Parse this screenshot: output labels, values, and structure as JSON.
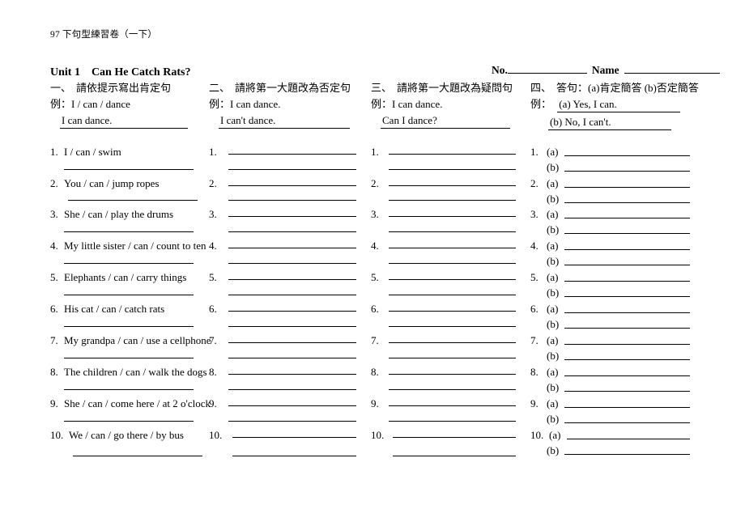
{
  "document": {
    "running_head": "97 下句型練習卷（一下）",
    "unit_title": "Unit 1　Can He Catch Rats?",
    "id_fields": {
      "no_label": "No.",
      "name_label": "Name"
    }
  },
  "sections": [
    {
      "number": "一、",
      "heading": "請依提示寫出肯定句",
      "example_label": "例：",
      "example_prompt": "I / can / dance",
      "example_answers": [
        "I can dance."
      ]
    },
    {
      "number": "二、",
      "heading": "請將第一大題改為否定句",
      "example_label": "例：",
      "example_prompt": "I can dance.",
      "example_answers": [
        "I can't dance."
      ]
    },
    {
      "number": "三、",
      "heading": "請將第一大題改為疑問句",
      "example_label": "例：",
      "example_prompt": "I can dance.",
      "example_answers": [
        "Can I dance?"
      ]
    },
    {
      "number": "四、",
      "heading": "答句：(a)肯定簡答 (b)否定簡答",
      "example_label": "例：",
      "example_prompt": "",
      "example_answers": [
        "(a) Yes, I can.",
        "(b) No, I can't."
      ]
    }
  ],
  "questions": {
    "numbers": [
      "1.",
      "2.",
      "3.",
      "4.",
      "5.",
      "6.",
      "7.",
      "8.",
      "9.",
      "10."
    ],
    "column1_prompts": [
      "I / can / swim",
      "You / can / jump ropes",
      "She / can / play the drums",
      "My little sister / can / count to ten",
      "Elephants / can / carry things",
      "His cat / can / catch rats",
      "My grandpa / can / use a cellphone",
      "The children / can / walk the dogs",
      "She / can / come here / at 2 o'clock",
      "We / can / go there / by bus"
    ],
    "column4_sub_labels": [
      "(a)",
      "(b)"
    ]
  }
}
